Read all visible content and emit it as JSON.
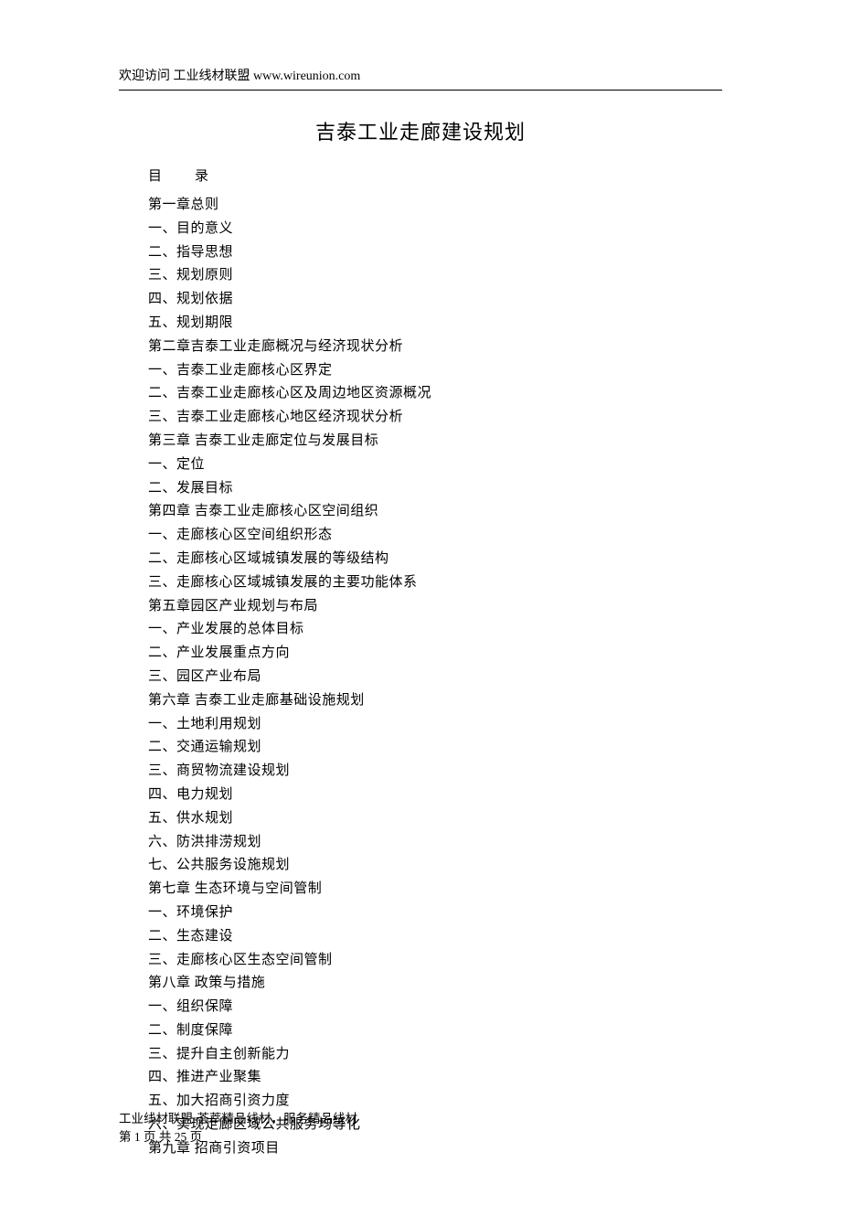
{
  "header": {
    "text": "欢迎访问  工业线材联盟  www.wireunion.com"
  },
  "title": "吉泰工业走廊建设规划",
  "toc_label": "目　　录",
  "toc": [
    "第一章总则",
    "一、目的意义",
    "二、指导思想",
    "三、规划原则",
    "四、规划依据",
    "五、规划期限",
    "第二章吉泰工业走廊概况与经济现状分析",
    "一、吉泰工业走廊核心区界定",
    "二、吉泰工业走廊核心区及周边地区资源概况",
    "三、吉泰工业走廊核心地区经济现状分析",
    "第三章  吉泰工业走廊定位与发展目标",
    "一、定位",
    "二、发展目标",
    "第四章  吉泰工业走廊核心区空间组织",
    "一、走廊核心区空间组织形态",
    "二、走廊核心区域城镇发展的等级结构",
    "三、走廊核心区域城镇发展的主要功能体系",
    "第五章园区产业规划与布局",
    "一、产业发展的总体目标",
    "二、产业发展重点方向",
    "三、园区产业布局",
    "第六章  吉泰工业走廊基础设施规划",
    "一、土地利用规划",
    "二、交通运输规划",
    "三、商贸物流建设规划",
    "四、电力规划",
    "五、供水规划",
    "六、防洪排涝规划",
    "七、公共服务设施规划",
    "第七章  生态环境与空间管制",
    "一、环境保护",
    "二、生态建设",
    "三、走廊核心区生态空间管制",
    "第八章  政策与措施",
    "一、组织保障",
    "二、制度保障",
    "三、提升自主创新能力",
    "四、推进产业聚集",
    "五、加大招商引资力度",
    "六、实现走廊区域公共服务均等化",
    "第九章  招商引资项目"
  ],
  "footer": {
    "line1": "工业线材联盟-荟萃精品线材，服务精品线材",
    "line2": "第  1  页  共  25  页"
  }
}
